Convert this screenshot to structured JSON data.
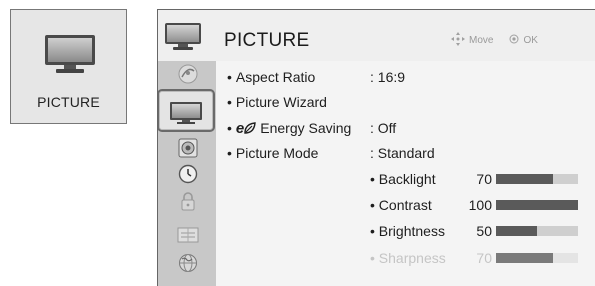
{
  "thumbnail": {
    "label": "PICTURE",
    "icon": "tv-icon"
  },
  "header": {
    "title": "PICTURE",
    "icon": "tv-icon",
    "move_hint": "Move",
    "ok_hint": "OK",
    "move_icon": "dpad-icon",
    "ok_icon": "ok-circle-icon"
  },
  "sidebar": {
    "items": [
      {
        "name": "satellite-dish-icon"
      },
      {
        "name": "tv-icon",
        "selected": true
      },
      {
        "name": "speaker-icon"
      },
      {
        "name": "clock-icon"
      },
      {
        "name": "lock-icon"
      },
      {
        "name": "options-box-icon"
      },
      {
        "name": "globe-icon"
      }
    ]
  },
  "settings": [
    {
      "bullet": "•",
      "label": "Aspect Ratio",
      "value": ": 16:9"
    },
    {
      "bullet": "•",
      "label": "Picture Wizard",
      "value": ""
    },
    {
      "bullet": "•",
      "label": "Energy Saving",
      "prefix": "e",
      "value": ": Off"
    },
    {
      "bullet": "•",
      "label": "Picture Mode",
      "value": ": Standard"
    }
  ],
  "sliders": [
    {
      "bullet": "•",
      "label": "Backlight",
      "value": "70",
      "level": 0.7,
      "dimmed": false
    },
    {
      "bullet": "•",
      "label": "Contrast",
      "value": "100",
      "level": 1.0,
      "dimmed": false
    },
    {
      "bullet": "•",
      "label": "Brightness",
      "value": "50",
      "level": 0.5,
      "dimmed": false
    },
    {
      "bullet": "•",
      "label": "Sharpness",
      "value": "70",
      "level": 0.7,
      "dimmed": true
    }
  ]
}
